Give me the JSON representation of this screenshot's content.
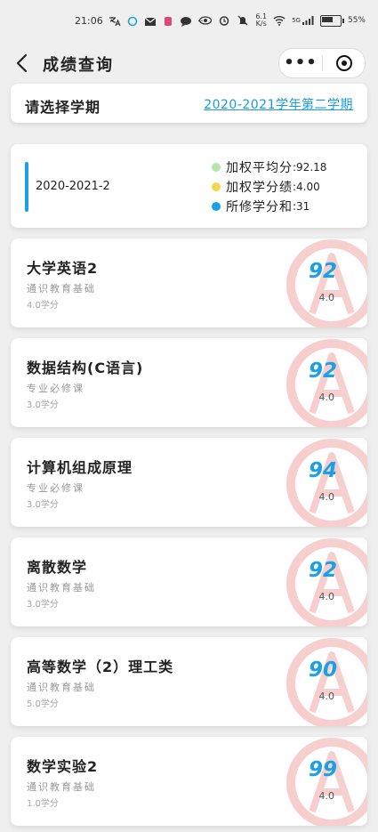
{
  "status_bar": {
    "time": "21:06",
    "network_speed": "6.1\nK/s",
    "signal": "5G",
    "battery": "55%"
  },
  "nav": {
    "title": "成绩查询"
  },
  "term_selector": {
    "label": "请选择学期",
    "value": "2020-2021学年第二学期"
  },
  "summary": {
    "term": "2020-2021-2",
    "stats": [
      {
        "label": "加权平均分",
        "value": ":92.18",
        "color": "#b8e6a8"
      },
      {
        "label": "加权学分绩",
        "value": ":4.00",
        "color": "#f4d84a"
      },
      {
        "label": "所修学分和",
        "value": ":31",
        "color": "#1aa0e6"
      }
    ]
  },
  "courses": [
    {
      "name": "大学英语2",
      "type": "通识教育基础",
      "credit": "4.0学分",
      "score": "92",
      "gpa": "4.0"
    },
    {
      "name": "数据结构(C语言)",
      "type": "专业必修课",
      "credit": "3.0学分",
      "score": "92",
      "gpa": "4.0"
    },
    {
      "name": "计算机组成原理",
      "type": "专业必修课",
      "credit": "3.0学分",
      "score": "94",
      "gpa": "4.0"
    },
    {
      "name": "离散数学",
      "type": "通识教育基础",
      "credit": "3.0学分",
      "score": "92",
      "gpa": "4.0"
    },
    {
      "name": "高等数学（2）理工类",
      "type": "通识教育基础",
      "credit": "5.0学分",
      "score": "90",
      "gpa": "4.0"
    },
    {
      "name": "数学实验2",
      "type": "通识教育基础",
      "credit": "1.0学分",
      "score": "99",
      "gpa": "4.0"
    }
  ],
  "colors": {
    "accent": "#1aa0e6",
    "stamp": "#e46a6a"
  }
}
